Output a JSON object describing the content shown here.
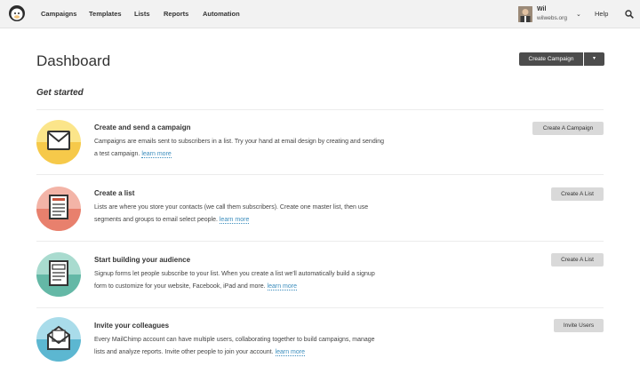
{
  "nav": {
    "logo_icon": "chimp-logo-icon",
    "links": [
      "Campaigns",
      "Templates",
      "Lists",
      "Reports",
      "Automation"
    ],
    "user": {
      "name": "Wil",
      "org": "wilwebs.org",
      "caret": "⌄"
    },
    "help": "Help",
    "search_icon": "search-icon"
  },
  "header": {
    "title": "Dashboard",
    "create_campaign": "Create Campaign",
    "create_caret": "▾"
  },
  "section": {
    "title": "Get started"
  },
  "rows": [
    {
      "icon": "envelope-icon",
      "color": "#f6c94a",
      "title": "Create and send a campaign",
      "desc": "Campaigns are emails sent to subscribers in a list. Try your hand at email design by creating and sending a test campaign.",
      "learn": "learn more",
      "button": "Create A Campaign"
    },
    {
      "icon": "list-icon",
      "color": "#e8806d",
      "title": "Create a list",
      "desc": "Lists are where you store your contacts (we call them subscribers). Create one master list, then use segments and groups to email select people.",
      "learn": "learn more",
      "button": "Create A List"
    },
    {
      "icon": "signup-form-icon",
      "color": "#64b8a6",
      "title": "Start building your audience",
      "desc": "Signup forms let people subscribe to your list. When you create a list we'll automatically build a signup form to customize for your website, Facebook, iPad and more.",
      "learn": "learn more",
      "button": "Create A List"
    },
    {
      "icon": "invite-envelope-icon",
      "color": "#5cb7d1",
      "title": "Invite your colleagues",
      "desc": "Every MailChimp account can have multiple users, collaborating together to build campaigns, manage lists and analyze reports. Invite other people to join your account.",
      "learn": "learn more",
      "button": "Invite Users"
    }
  ]
}
